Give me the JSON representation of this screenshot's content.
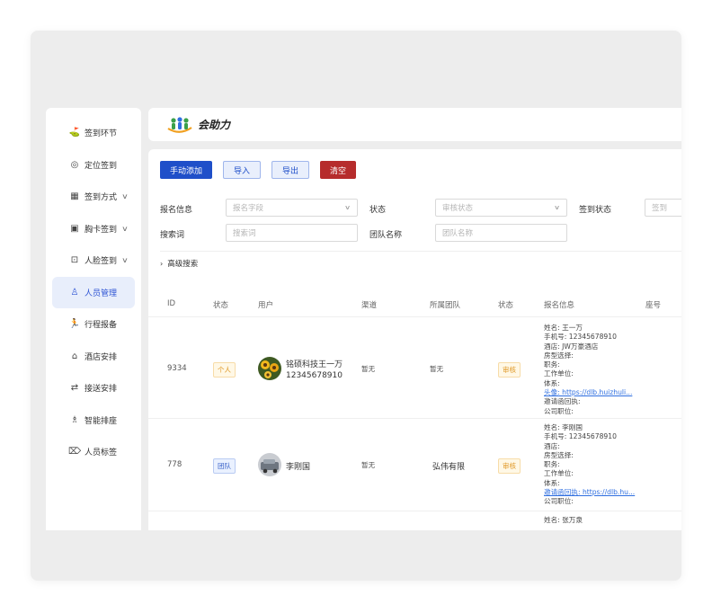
{
  "header": {
    "logo_text": "会助力"
  },
  "sidebar": {
    "items": [
      {
        "label": "签到环节",
        "icon": "flag-icon",
        "glyph": "⛳",
        "chevron": false,
        "active": false
      },
      {
        "label": "定位签到",
        "icon": "target-icon",
        "glyph": "◎",
        "chevron": false,
        "active": false
      },
      {
        "label": "签到方式",
        "icon": "qrcode-icon",
        "glyph": "▦",
        "chevron": true,
        "active": false
      },
      {
        "label": "胸卡签到",
        "icon": "badge-icon",
        "glyph": "▣",
        "chevron": true,
        "active": false
      },
      {
        "label": "人脸签到",
        "icon": "face-scan-icon",
        "glyph": "⊡",
        "chevron": true,
        "active": false
      },
      {
        "label": "人员管理",
        "icon": "user-icon",
        "glyph": "♙",
        "chevron": false,
        "active": true
      },
      {
        "label": "行程报备",
        "icon": "walk-icon",
        "glyph": "🏃",
        "chevron": false,
        "active": false
      },
      {
        "label": "酒店安排",
        "icon": "hotel-icon",
        "glyph": "⌂",
        "chevron": false,
        "active": false
      },
      {
        "label": "接送安排",
        "icon": "transfer-icon",
        "glyph": "⇄",
        "chevron": false,
        "active": false
      },
      {
        "label": "智能排座",
        "icon": "seat-icon",
        "glyph": "♗",
        "chevron": false,
        "active": false
      },
      {
        "label": "人员标签",
        "icon": "tag-icon",
        "glyph": "⌦",
        "chevron": false,
        "active": false
      }
    ]
  },
  "toolbar": {
    "add_label": "手动添加",
    "import_label": "导入",
    "export_label": "导出",
    "clear_label": "清空"
  },
  "filters": {
    "signup_info_label": "报名信息",
    "signup_field_placeholder": "报名字段",
    "status_label": "状态",
    "review_status_placeholder": "审核状态",
    "checkin_status_label": "签到状态",
    "checkin_status_placeholder": "签到",
    "keyword_label": "搜索词",
    "keyword_placeholder": "搜索词",
    "team_label": "团队名称",
    "team_placeholder": "团队名称"
  },
  "advanced_search": "高级搜索",
  "table": {
    "headers": [
      "ID",
      "状态",
      "用户",
      "渠道",
      "所属团队",
      "状态",
      "报名信息",
      "座号"
    ],
    "rows": [
      {
        "id": "9334",
        "type": "个人",
        "user_name": "铭硕科技王一万",
        "user_phone": "12345678910",
        "channel": "暂无",
        "team": "暂无",
        "review": "审核",
        "info": [
          "姓名: 王一万",
          "手机号: 12345678910",
          "酒店: JW万豪酒店",
          "房型选择:",
          "职务:",
          "工作单位:",
          "体系:"
        ],
        "info_link": "头像: https://dlb.huizhuli...",
        "info_tail": [
          "邀请函回执:",
          "公司职位:"
        ]
      },
      {
        "id": "778",
        "type": "团队",
        "user_name": "李刚国",
        "user_phone": "",
        "channel": "暂无",
        "team": "弘伟有限",
        "review": "审核",
        "info": [
          "姓名: 李刚国",
          "手机号: 12345678910",
          "酒店:",
          "房型选择:",
          "职务:",
          "工作单位:",
          "体系:"
        ],
        "info_link": "邀请函回执: https://dlb.hu...",
        "info_tail": [
          "公司职位:"
        ]
      },
      {
        "info": [
          "姓名: 张万泉"
        ]
      }
    ]
  }
}
